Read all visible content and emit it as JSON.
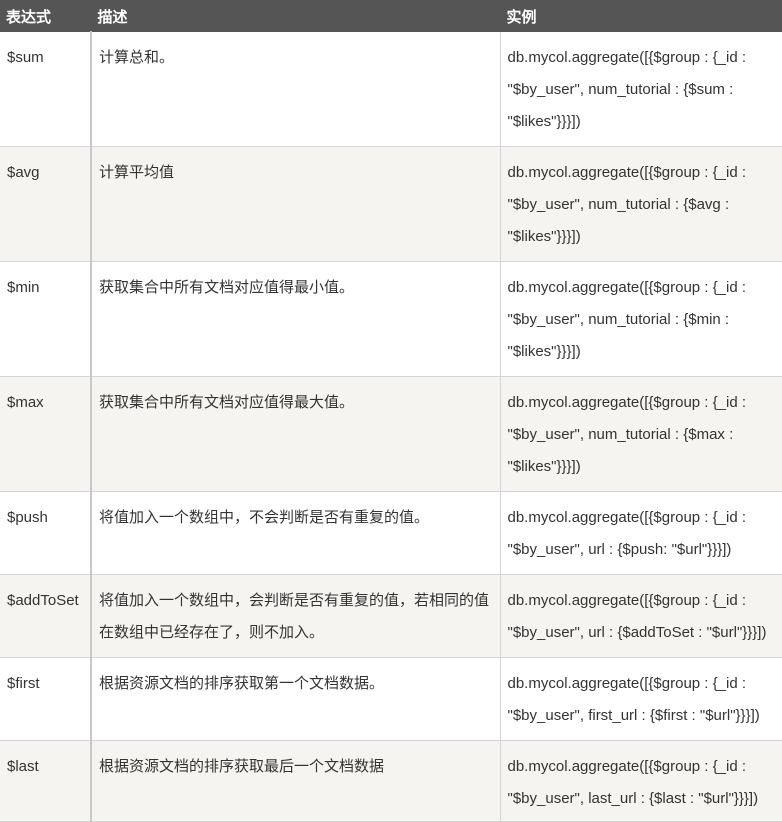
{
  "header": {
    "col_expression": "表达式",
    "col_description": "描述",
    "col_example": "实例"
  },
  "rows": [
    {
      "expression": "$sum",
      "description": "计算总和。",
      "example": [
        "db.mycol.aggregate([{$group : {_id :",
        "\"$by_user\", num_tutorial : {$sum :",
        "\"$likes\"}}}])"
      ]
    },
    {
      "expression": "$avg",
      "description": "计算平均值",
      "example": [
        "db.mycol.aggregate([{$group : {_id :",
        "\"$by_user\", num_tutorial : {$avg :",
        "\"$likes\"}}}])"
      ]
    },
    {
      "expression": "$min",
      "description": "获取集合中所有文档对应值得最小值。",
      "example": [
        "db.mycol.aggregate([{$group : {_id :",
        "\"$by_user\", num_tutorial : {$min :",
        "\"$likes\"}}}])"
      ]
    },
    {
      "expression": "$max",
      "description": "获取集合中所有文档对应值得最大值。",
      "example": [
        "db.mycol.aggregate([{$group : {_id :",
        "\"$by_user\", num_tutorial : {$max :",
        "\"$likes\"}}}])"
      ]
    },
    {
      "expression": "$push",
      "description": "将值加入一个数组中，不会判断是否有重复的值。",
      "example": [
        "db.mycol.aggregate([{$group : {_id :",
        "\"$by_user\", url : {$push: \"$url\"}}}])"
      ]
    },
    {
      "expression": "$addToSet",
      "description": "将值加入一个数组中，会判断是否有重复的值，若相同的值在数组中已经存在了，则不加入。",
      "example": [
        "db.mycol.aggregate([{$group : {_id :",
        "\"$by_user\", url : {$addToSet : \"$url\"}}}])"
      ]
    },
    {
      "expression": "$first",
      "description": "根据资源文档的排序获取第一个文档数据。",
      "example": [
        "db.mycol.aggregate([{$group : {_id :",
        "\"$by_user\", first_url : {$first : \"$url\"}}}])"
      ]
    },
    {
      "expression": "$last",
      "description": "根据资源文档的排序获取最后一个文档数据",
      "example": [
        "db.mycol.aggregate([{$group : {_id :",
        "\"$by_user\", last_url : {$last : \"$url\"}}}])"
      ]
    }
  ]
}
